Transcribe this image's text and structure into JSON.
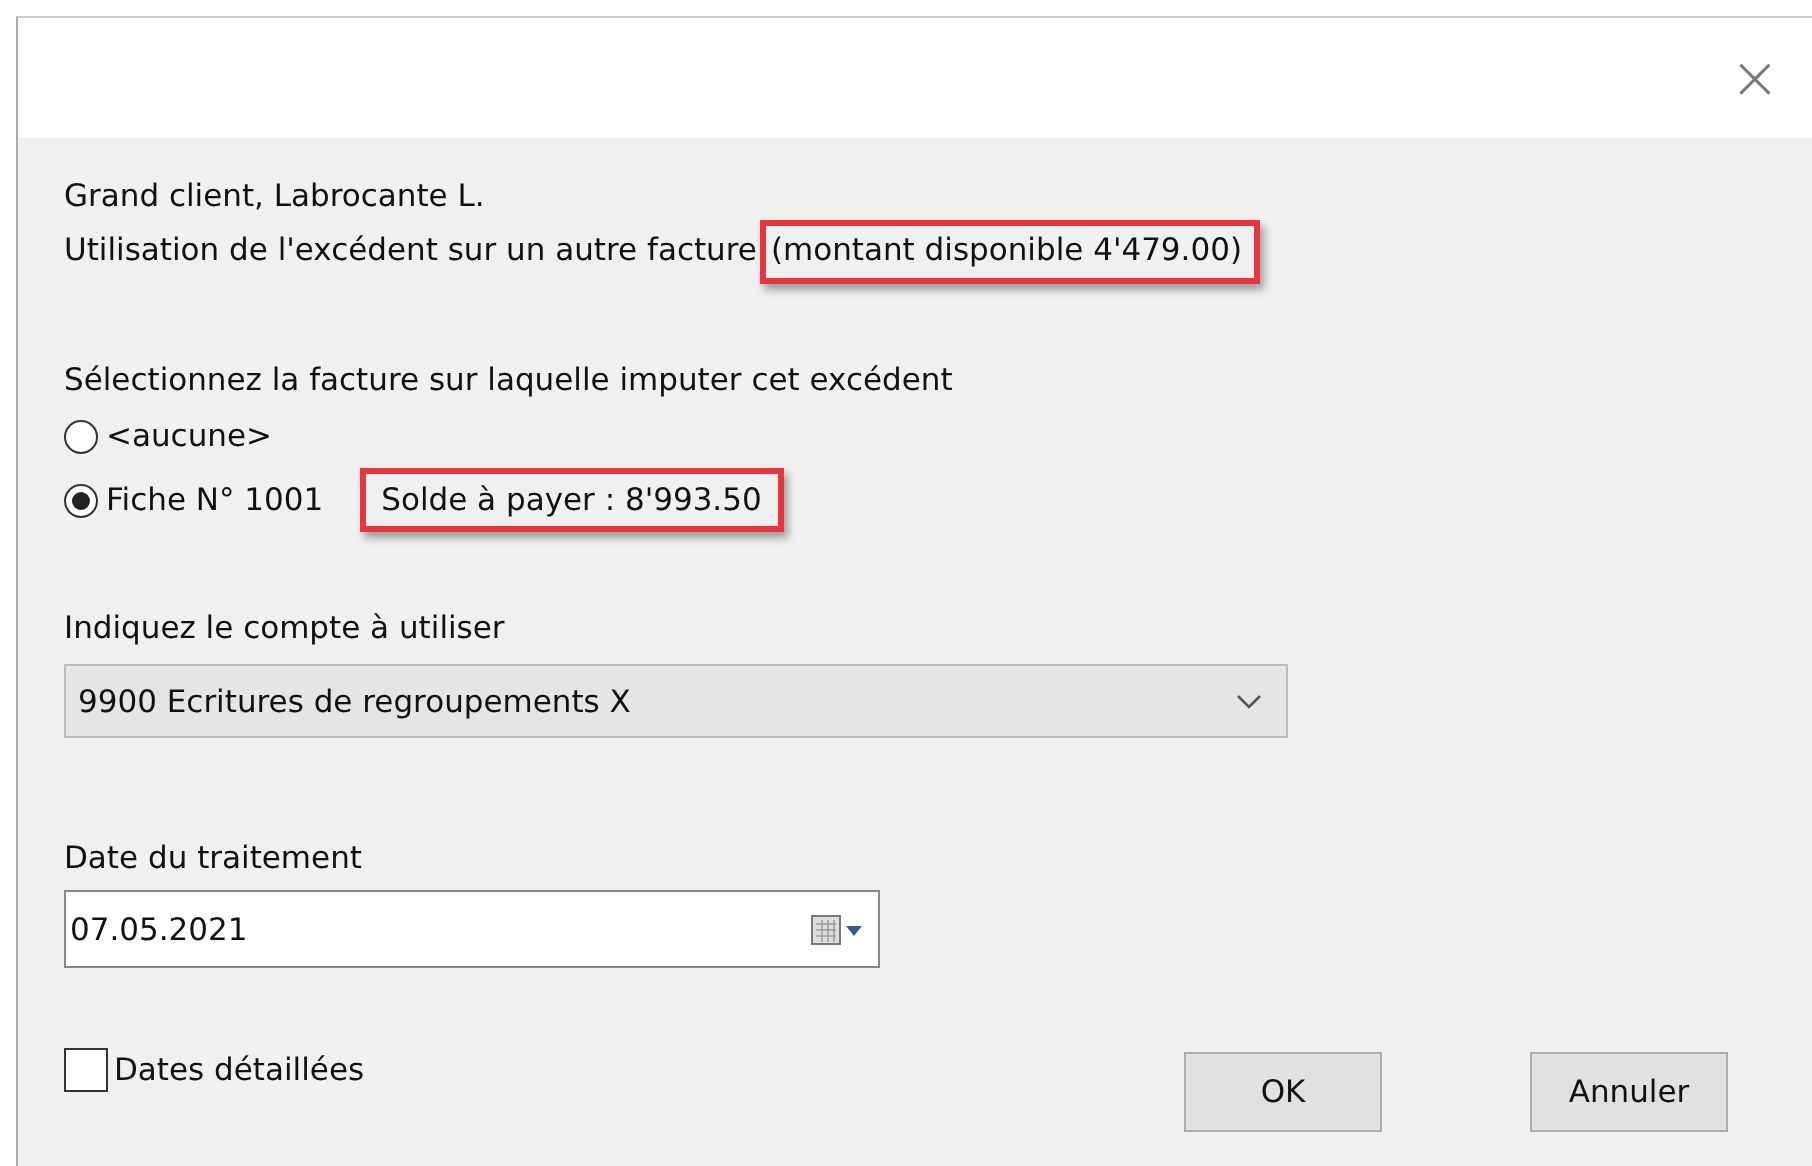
{
  "window": {
    "close": "×"
  },
  "client": "Grand client, Labrocante L.",
  "usage": {
    "text": "Utilisation de l'excédent sur un autre facture",
    "available": "(montant disponible 4'479.00)"
  },
  "invoice_prompt": "Sélectionnez la facture sur laquelle imputer cet excédent",
  "options": [
    {
      "label": "<aucune>",
      "selected": false
    },
    {
      "label": "Fiche N°  1001",
      "selected": true,
      "balance": "Solde à payer : 8'993.50"
    }
  ],
  "account": {
    "label": "Indiquez le compte à utiliser",
    "value": "9900 Ecritures de regroupements X"
  },
  "date": {
    "label": "Date du traitement",
    "value": "07.05.2021"
  },
  "detailed_dates": {
    "label": "Dates détaillées",
    "checked": false
  },
  "buttons": [
    "OK",
    "Annuler"
  ]
}
